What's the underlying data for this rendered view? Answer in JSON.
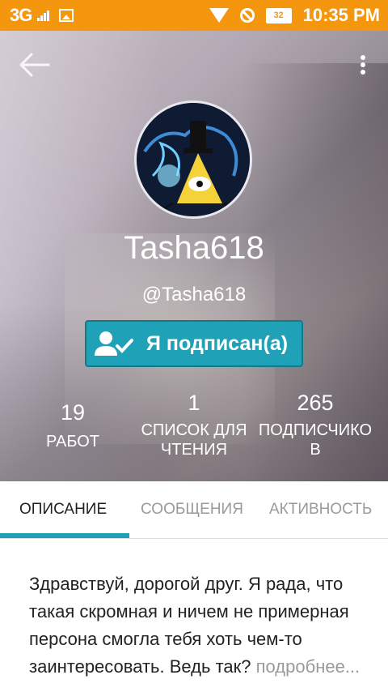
{
  "status_bar": {
    "network": "3G",
    "battery": "32",
    "time": "10:35 PM"
  },
  "profile": {
    "username": "Tasha618",
    "handle": "@Tasha618",
    "follow_label": "Я подписан(а)"
  },
  "stats": [
    {
      "value": "19",
      "label_lines": [
        "РАБОТ"
      ]
    },
    {
      "value": "1",
      "label_lines": [
        "СПИСОК ДЛЯ",
        "ЧТЕНИЯ"
      ]
    },
    {
      "value": "265",
      "label_lines": [
        "ПОДПИСЧИКО",
        "В"
      ]
    }
  ],
  "tabs": [
    {
      "label": "ОПИСАНИЕ",
      "active": true
    },
    {
      "label": "СООБЩЕНИЯ",
      "active": false
    },
    {
      "label": "АКТИВНОСТЬ",
      "active": false
    }
  ],
  "description": {
    "text": "Здравствуй, дорогой друг. Я рада, что такая скромная и ничем не примерная персона смогла тебя хоть чем-то заинтересовать. Ведь так?",
    "more_label": "подробнее..."
  },
  "colors": {
    "status_bar": "#f5960f",
    "accent": "#1fa2b7"
  },
  "icons": [
    "back-arrow-icon",
    "more-vert-icon",
    "user-check-icon",
    "wifi-icon",
    "block-icon",
    "battery-icon",
    "signal-icon",
    "image-icon"
  ]
}
